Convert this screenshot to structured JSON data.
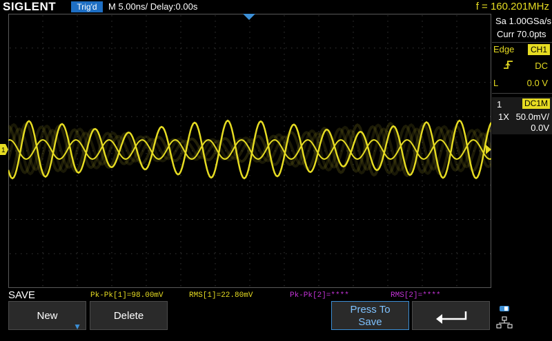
{
  "header": {
    "logo": "SIGLENT",
    "trigger_status": "Trig'd",
    "timebase": "M 5.00ns/  Delay:0.00s",
    "frequency": "f = 160.201MHz"
  },
  "right_panel": {
    "sample_rate": "Sa 1.00GSa/s",
    "memory_depth": "Curr 70.0pts",
    "trigger_type": "Edge",
    "trigger_source": "CH1",
    "trigger_coupling": "DC",
    "level_label": "L",
    "level_value": "0.0 V",
    "channel_number": "1",
    "channel_coupling": "DC1M",
    "probe": "1X",
    "volts_per_div": "50.0mV/",
    "offset": "0.0V"
  },
  "bottom": {
    "menu_title": "SAVE",
    "measurements": [
      {
        "text": "Pk-Pk[1]=98.00mV"
      },
      {
        "text": "RMS[1]=22.80mV"
      },
      {
        "text": "Pk-Pk[2]=****"
      },
      {
        "text": "RMS[2]=****"
      }
    ],
    "softkeys": {
      "new": "New",
      "delete": "Delete",
      "press_to_save_line1": "Press To",
      "press_to_save_line2": "Save"
    }
  },
  "colors": {
    "ch1": "#e6dc22",
    "ch2": "#c233d6",
    "accent": "#1e6fc4"
  },
  "icons": [
    "edge-rising-icon",
    "return-arrow-icon",
    "network-icon",
    "down-arrow-icon",
    "trigger-position-icon"
  ]
}
